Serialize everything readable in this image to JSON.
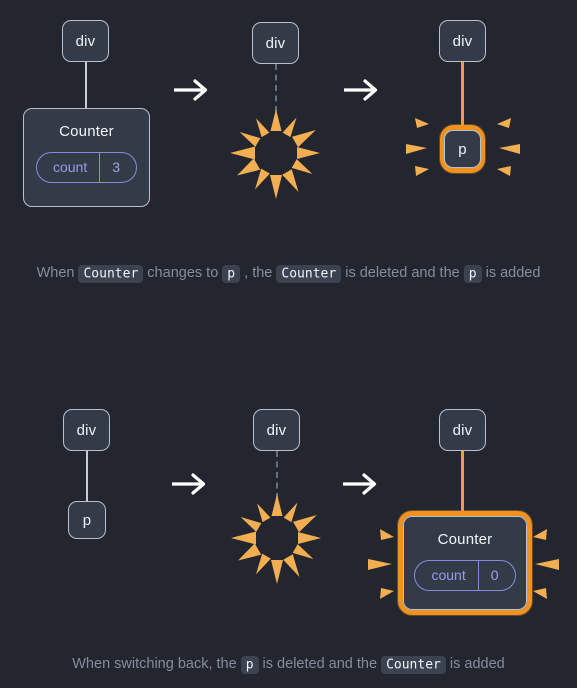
{
  "theme": {
    "background": "#23262f",
    "node_fill": "#343b48",
    "node_border": "#b9bfcb",
    "accent_orange": "#f0921f",
    "ray_orange": "#f3b254",
    "pill_purple": "#868cdd",
    "caption_text": "#858c9e",
    "chip_bg": "#3b4250"
  },
  "diagrams": [
    {
      "id": "counter-to-p",
      "steps": [
        {
          "kind": "tree",
          "parent": {
            "label": "div",
            "name": "div-node"
          },
          "connector": "solid",
          "child": {
            "kind": "card",
            "title": "Counter",
            "state": {
              "key": "count",
              "value": "3"
            }
          }
        },
        {
          "kind": "arrow",
          "glyph": "→",
          "name": "flow-arrow"
        },
        {
          "kind": "tree",
          "parent": {
            "label": "div",
            "name": "div-node"
          },
          "connector": "dashed",
          "child": {
            "kind": "burst",
            "name": "delete-burst"
          }
        },
        {
          "kind": "arrow",
          "glyph": "→",
          "name": "flow-arrow"
        },
        {
          "kind": "tree",
          "parent": {
            "label": "div",
            "name": "div-node"
          },
          "connector": "orange",
          "child": {
            "kind": "node",
            "label": "p",
            "highlighted": true
          }
        }
      ],
      "caption": {
        "parts": [
          {
            "t": "text",
            "v": "When "
          },
          {
            "t": "code",
            "v": "Counter"
          },
          {
            "t": "text",
            "v": " changes to "
          },
          {
            "t": "code",
            "v": "p"
          },
          {
            "t": "text",
            "v": " , the "
          },
          {
            "t": "code",
            "v": "Counter"
          },
          {
            "t": "text",
            "v": " is deleted and the "
          },
          {
            "t": "code",
            "v": "p"
          },
          {
            "t": "text",
            "v": " is added"
          }
        ],
        "plain": "When Counter changes to p , the Counter is deleted and the p is added"
      }
    },
    {
      "id": "p-to-counter",
      "steps": [
        {
          "kind": "tree",
          "parent": {
            "label": "div",
            "name": "div-node"
          },
          "connector": "solid",
          "child": {
            "kind": "node",
            "label": "p",
            "highlighted": false
          }
        },
        {
          "kind": "arrow",
          "glyph": "→",
          "name": "flow-arrow"
        },
        {
          "kind": "tree",
          "parent": {
            "label": "div",
            "name": "div-node"
          },
          "connector": "dashed",
          "child": {
            "kind": "burst",
            "name": "delete-burst"
          }
        },
        {
          "kind": "arrow",
          "glyph": "→",
          "name": "flow-arrow"
        },
        {
          "kind": "tree",
          "parent": {
            "label": "div",
            "name": "div-node"
          },
          "connector": "orange",
          "child": {
            "kind": "card",
            "title": "Counter",
            "state": {
              "key": "count",
              "value": "0"
            },
            "highlighted": true
          }
        }
      ],
      "caption": {
        "parts": [
          {
            "t": "text",
            "v": "When switching back, the "
          },
          {
            "t": "code",
            "v": "p"
          },
          {
            "t": "text",
            "v": " is deleted and the "
          },
          {
            "t": "code",
            "v": "Counter"
          },
          {
            "t": "text",
            "v": " is added"
          }
        ],
        "plain": "When switching back, the p is deleted and the Counter is added"
      }
    }
  ]
}
